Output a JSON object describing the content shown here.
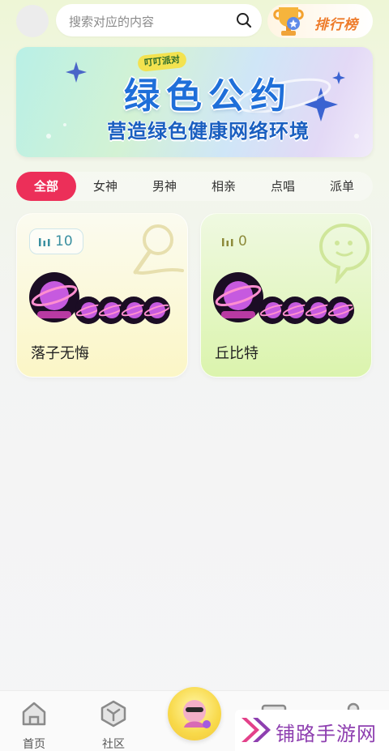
{
  "header": {
    "search_placeholder": "搜索对应的内容",
    "ranking_label": "排行榜"
  },
  "banner": {
    "tag": "叮叮派对",
    "title": "绿色公约",
    "subtitle": "营造绿色健康网络环境"
  },
  "tabs": [
    {
      "label": "全部",
      "active": true
    },
    {
      "label": "女神",
      "active": false
    },
    {
      "label": "男神",
      "active": false
    },
    {
      "label": "相亲",
      "active": false
    },
    {
      "label": "点唱",
      "active": false
    },
    {
      "label": "派单",
      "active": false
    }
  ],
  "rooms": [
    {
      "name": "落子无悔",
      "count": "10",
      "theme": "yellow",
      "deco_icon": "microphone-icon"
    },
    {
      "name": "丘比特",
      "count": "0",
      "theme": "green",
      "deco_icon": "chat-bubble-icon"
    }
  ],
  "bottom_nav": [
    {
      "label": "首页",
      "icon": "home-icon"
    },
    {
      "label": "社区",
      "icon": "community-icon"
    },
    {
      "label": "",
      "icon": "center-avatar-icon"
    },
    {
      "label": "",
      "icon": "message-icon"
    },
    {
      "label": "",
      "icon": "profile-icon"
    }
  ],
  "watermark": {
    "text": "铺路手游网"
  },
  "colors": {
    "accent": "#ec2f59",
    "rank_text": "#ee7b2a",
    "banner_title": "#1f6fd9"
  }
}
